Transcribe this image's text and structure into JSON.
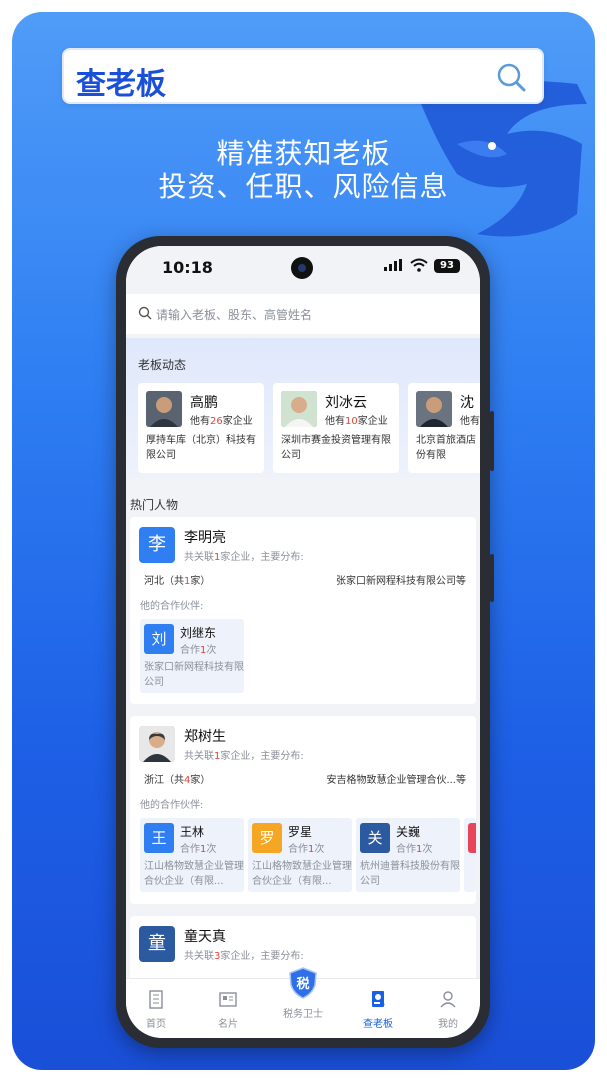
{
  "banner": {
    "app_title": "查老板",
    "headline_1": "精准获知老板",
    "headline_2": "投资、任职、风险信息",
    "search_icon": "search-icon",
    "brand_color": "#1a4fd8"
  },
  "status_bar": {
    "time": "10:18",
    "battery": "93"
  },
  "search": {
    "placeholder": "请输入老板、股东、高管姓名"
  },
  "boss_dynamics": {
    "header": "老板动态",
    "cards": [
      {
        "name": "高鹏",
        "count_prefix": "他有",
        "count": "26",
        "count_suffix": "家企业",
        "company": "厚持车库（北京）科技有限公司"
      },
      {
        "name": "刘冰云",
        "count_prefix": "他有",
        "count": "10",
        "count_suffix": "家企业",
        "company": "深圳市赛金投资管理有限公司"
      },
      {
        "name": "沈",
        "count_prefix": "他有",
        "count": "",
        "count_suffix": "",
        "company": "北京首旅酒店（集团）股份有限"
      }
    ]
  },
  "hot_people": {
    "header": "热门人物",
    "partner_label": "他的合作伙伴:",
    "people": [
      {
        "avatar_char": "李",
        "name": "李明亮",
        "sub_prefix": "共关联",
        "count": "1",
        "sub_suffix": "家企业，主要分布:",
        "region": "河北（共",
        "region_count": "1",
        "region_suffix": "家）",
        "region_company": "张家口新网程科技有限公司等",
        "partners": [
          {
            "char": "刘",
            "name": "刘继东",
            "coop_prefix": "合作",
            "coop": "1",
            "coop_suffix": "次",
            "company": "张家口新网程科技有限公司"
          }
        ]
      },
      {
        "avatar_char": "",
        "name": "郑树生",
        "sub_prefix": "共关联",
        "count": "1",
        "sub_suffix": "家企业，主要分布:",
        "region": "浙江（共",
        "region_count": "4",
        "region_suffix": "家）",
        "region_company": "安吉格物致慧企业管理合伙...等",
        "partners": [
          {
            "char": "王",
            "name": "王林",
            "coop_prefix": "合作",
            "coop": "1",
            "coop_suffix": "次",
            "company": "江山格物致慧企业管理合伙企业（有限..."
          },
          {
            "char": "罗",
            "name": "罗星",
            "coop_prefix": "合作",
            "coop": "1",
            "coop_suffix": "次",
            "company": "江山格物致慧企业管理合伙企业（有限..."
          },
          {
            "char": "关",
            "name": "关巍",
            "coop_prefix": "合作",
            "coop": "1",
            "coop_suffix": "次",
            "company": "杭州迪普科技股份有限公司"
          }
        ]
      },
      {
        "avatar_char": "童",
        "name": "童天真",
        "sub_prefix": "共关联",
        "count": "3",
        "sub_suffix": "家企业，主要分布:"
      }
    ]
  },
  "tabbar": {
    "items": [
      {
        "label": "首页",
        "icon": "building-icon"
      },
      {
        "label": "名片",
        "icon": "card-icon"
      },
      {
        "label": "税务卫士",
        "icon": "tax-shield-icon",
        "badge_char": "税"
      },
      {
        "label": "查老板",
        "icon": "boss-search-icon",
        "active": true
      },
      {
        "label": "我的",
        "icon": "user-icon"
      }
    ]
  },
  "colors": {
    "accent": "#1a5fe8",
    "highlight": "#e0443a",
    "blue_avatar": "#2f7ef2",
    "orange_avatar": "#f5a623",
    "navy_avatar": "#2c5aa0",
    "red_avatar": "#e8455a"
  }
}
